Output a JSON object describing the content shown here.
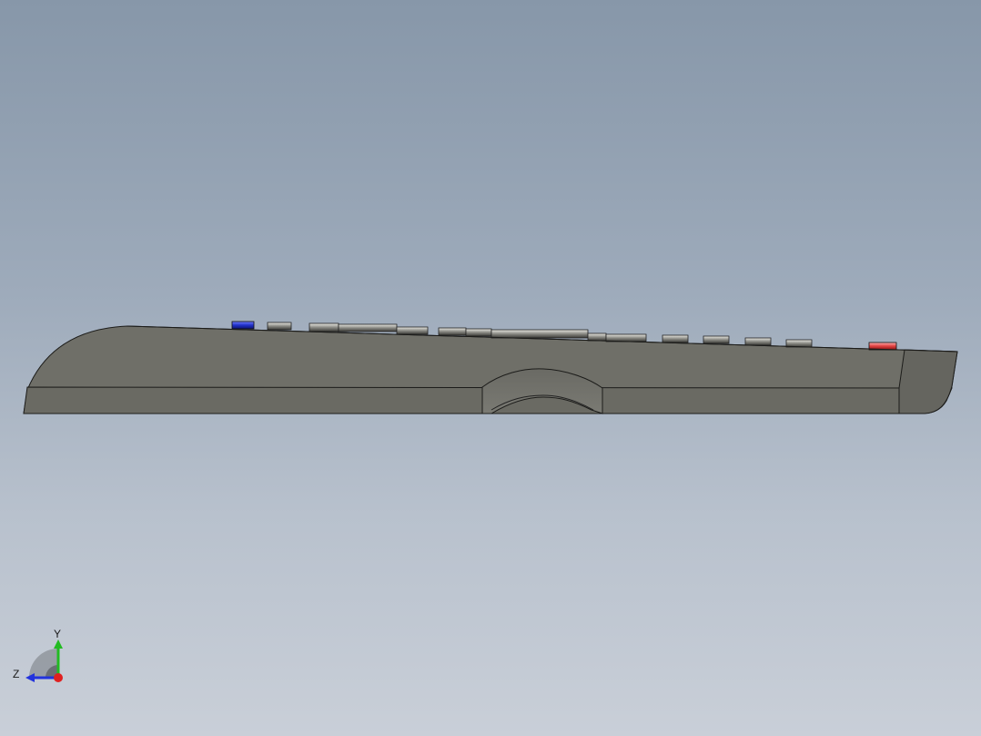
{
  "viewport": {
    "background_top": "#8797a9",
    "background_bottom": "#c9cfd8"
  },
  "model": {
    "body_color": "#6f6f68",
    "button_left_accent": "#2030c8",
    "button_right_accent": "#e04040"
  },
  "triad": {
    "y_label": "Y",
    "z_label": "Z",
    "y_color": "#22bb22",
    "z_color": "#2233dd",
    "x_color": "#e02020"
  }
}
